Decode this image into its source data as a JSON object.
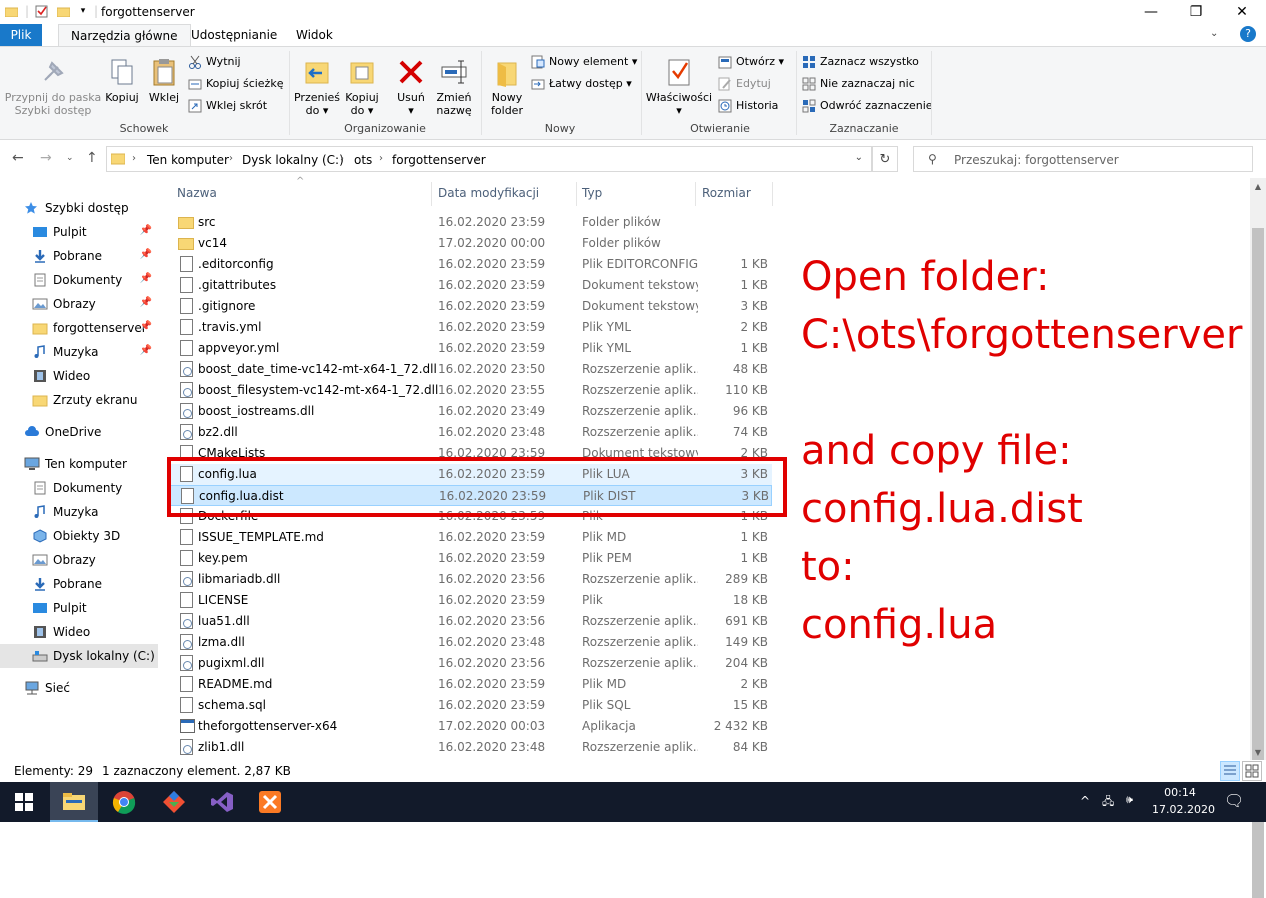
{
  "window": {
    "title": "forgottenserver",
    "minimize": "—",
    "maximize": "❐",
    "close": "✕",
    "help": "?"
  },
  "tabs": [
    {
      "label": "Plik"
    },
    {
      "label": "Narzędzia główne"
    },
    {
      "label": "Udostępnianie"
    },
    {
      "label": "Widok"
    }
  ],
  "ribbon": {
    "pin_label": "Przypnij do paska\nSzybki dostęp",
    "copy_label": "Kopiuj",
    "paste_label": "Wklej",
    "cut_label": "Wytnij",
    "copy_path_label": "Kopiuj ścieżkę",
    "paste_shortcut_label": "Wklej skrót",
    "clipboard_group": "Schowek",
    "move_to_label": "Przenieś\ndo ▾",
    "copy_to_label": "Kopiuj\ndo ▾",
    "delete_label": "Usuń\n▾",
    "rename_label": "Zmień\nnazwę",
    "organize_group": "Organizowanie",
    "new_folder_label": "Nowy\nfolder",
    "new_item_label": "Nowy element ▾",
    "easy_access_label": "Łatwy dostęp ▾",
    "new_group": "Nowy",
    "properties_label": "Właściwości\n▾",
    "open_label": "Otwórz ▾",
    "edit_label": "Edytuj",
    "history_label": "Historia",
    "open_group": "Otwieranie",
    "select_all_label": "Zaznacz wszystko",
    "select_none_label": "Nie zaznaczaj nic",
    "invert_selection_label": "Odwróć zaznaczenie",
    "select_group": "Zaznaczanie"
  },
  "address": {
    "crumbs": [
      "Ten komputer",
      "Dysk lokalny (C:)",
      "ots",
      "forgottenserver"
    ],
    "search_placeholder": "Przeszukaj: forgottenserver"
  },
  "sidebar": [
    {
      "label": "Szybki dostęp",
      "icon": "star-icon",
      "pinned": false,
      "indent": 0
    },
    {
      "label": "Pulpit",
      "icon": "desktop-icon",
      "pinned": true,
      "indent": 1
    },
    {
      "label": "Pobrane",
      "icon": "download-icon",
      "pinned": true,
      "indent": 1
    },
    {
      "label": "Dokumenty",
      "icon": "documents-icon",
      "pinned": true,
      "indent": 1
    },
    {
      "label": "Obrazy",
      "icon": "pictures-icon",
      "pinned": true,
      "indent": 1
    },
    {
      "label": "forgottenserver",
      "icon": "folder-icon",
      "pinned": true,
      "indent": 1
    },
    {
      "label": "Muzyka",
      "icon": "music-icon",
      "pinned": true,
      "indent": 1
    },
    {
      "label": "Wideo",
      "icon": "video-icon",
      "pinned": false,
      "indent": 1
    },
    {
      "label": "Zrzuty ekranu",
      "icon": "folder-icon",
      "pinned": false,
      "indent": 1
    },
    {
      "label": "OneDrive",
      "icon": "cloud-icon",
      "pinned": false,
      "indent": 0
    },
    {
      "label": "Ten komputer",
      "icon": "computer-icon",
      "pinned": false,
      "indent": 0
    },
    {
      "label": "Dokumenty",
      "icon": "documents-icon",
      "pinned": false,
      "indent": 1
    },
    {
      "label": "Muzyka",
      "icon": "music-icon",
      "pinned": false,
      "indent": 1
    },
    {
      "label": "Obiekty 3D",
      "icon": "cube-icon",
      "pinned": false,
      "indent": 1
    },
    {
      "label": "Obrazy",
      "icon": "pictures-icon",
      "pinned": false,
      "indent": 1
    },
    {
      "label": "Pobrane",
      "icon": "download-icon",
      "pinned": false,
      "indent": 1
    },
    {
      "label": "Pulpit",
      "icon": "desktop-icon",
      "pinned": false,
      "indent": 1
    },
    {
      "label": "Wideo",
      "icon": "video-icon",
      "pinned": false,
      "indent": 1
    },
    {
      "label": "Dysk lokalny (C:)",
      "icon": "drive-icon",
      "pinned": false,
      "indent": 1,
      "selected": true
    },
    {
      "label": "Sieć",
      "icon": "network-icon",
      "pinned": false,
      "indent": 0
    }
  ],
  "columns": {
    "name": "Nazwa",
    "date": "Data modyfikacji",
    "type": "Typ",
    "size": "Rozmiar"
  },
  "files": [
    {
      "name": "src",
      "date": "16.02.2020 23:59",
      "type": "Folder plików",
      "size": "",
      "icon": "folder"
    },
    {
      "name": "vc14",
      "date": "17.02.2020 00:00",
      "type": "Folder plików",
      "size": "",
      "icon": "folder"
    },
    {
      "name": ".editorconfig",
      "date": "16.02.2020 23:59",
      "type": "Plik EDITORCONFIG",
      "size": "1 KB",
      "icon": "doc"
    },
    {
      "name": ".gitattributes",
      "date": "16.02.2020 23:59",
      "type": "Dokument tekstowy",
      "size": "1 KB",
      "icon": "doc"
    },
    {
      "name": ".gitignore",
      "date": "16.02.2020 23:59",
      "type": "Dokument tekstowy",
      "size": "3 KB",
      "icon": "doc"
    },
    {
      "name": ".travis.yml",
      "date": "16.02.2020 23:59",
      "type": "Plik YML",
      "size": "2 KB",
      "icon": "doc"
    },
    {
      "name": "appveyor.yml",
      "date": "16.02.2020 23:59",
      "type": "Plik YML",
      "size": "1 KB",
      "icon": "doc"
    },
    {
      "name": "boost_date_time-vc142-mt-x64-1_72.dll",
      "date": "16.02.2020 23:50",
      "type": "Rozszerzenie aplik...",
      "size": "48 KB",
      "icon": "dll"
    },
    {
      "name": "boost_filesystem-vc142-mt-x64-1_72.dll",
      "date": "16.02.2020 23:55",
      "type": "Rozszerzenie aplik...",
      "size": "110 KB",
      "icon": "dll"
    },
    {
      "name": "boost_iostreams.dll",
      "date": "16.02.2020 23:49",
      "type": "Rozszerzenie aplik...",
      "size": "96 KB",
      "icon": "dll"
    },
    {
      "name": "bz2.dll",
      "date": "16.02.2020 23:48",
      "type": "Rozszerzenie aplik...",
      "size": "74 KB",
      "icon": "dll"
    },
    {
      "name": "CMakeLists",
      "date": "16.02.2020 23:59",
      "type": "Dokument tekstowy",
      "size": "2 KB",
      "icon": "doc"
    },
    {
      "name": "config.lua",
      "date": "16.02.2020 23:59",
      "type": "Plik LUA",
      "size": "3 KB",
      "icon": "doc",
      "state": "hl"
    },
    {
      "name": "config.lua.dist",
      "date": "16.02.2020 23:59",
      "type": "Plik DIST",
      "size": "3 KB",
      "icon": "doc",
      "state": "sel"
    },
    {
      "name": "Dockerfile",
      "date": "16.02.2020 23:59",
      "type": "Plik",
      "size": "1 KB",
      "icon": "doc"
    },
    {
      "name": "ISSUE_TEMPLATE.md",
      "date": "16.02.2020 23:59",
      "type": "Plik MD",
      "size": "1 KB",
      "icon": "doc"
    },
    {
      "name": "key.pem",
      "date": "16.02.2020 23:59",
      "type": "Plik PEM",
      "size": "1 KB",
      "icon": "doc"
    },
    {
      "name": "libmariadb.dll",
      "date": "16.02.2020 23:56",
      "type": "Rozszerzenie aplik...",
      "size": "289 KB",
      "icon": "dll"
    },
    {
      "name": "LICENSE",
      "date": "16.02.2020 23:59",
      "type": "Plik",
      "size": "18 KB",
      "icon": "doc"
    },
    {
      "name": "lua51.dll",
      "date": "16.02.2020 23:56",
      "type": "Rozszerzenie aplik...",
      "size": "691 KB",
      "icon": "dll"
    },
    {
      "name": "lzma.dll",
      "date": "16.02.2020 23:48",
      "type": "Rozszerzenie aplik...",
      "size": "149 KB",
      "icon": "dll"
    },
    {
      "name": "pugixml.dll",
      "date": "16.02.2020 23:56",
      "type": "Rozszerzenie aplik...",
      "size": "204 KB",
      "icon": "dll"
    },
    {
      "name": "README.md",
      "date": "16.02.2020 23:59",
      "type": "Plik MD",
      "size": "2 KB",
      "icon": "doc"
    },
    {
      "name": "schema.sql",
      "date": "16.02.2020 23:59",
      "type": "Plik SQL",
      "size": "15 KB",
      "icon": "doc"
    },
    {
      "name": "theforgottenserver-x64",
      "date": "17.02.2020 00:03",
      "type": "Aplikacja",
      "size": "2 432 KB",
      "icon": "exe"
    },
    {
      "name": "zlib1.dll",
      "date": "16.02.2020 23:48",
      "type": "Rozszerzenie aplik...",
      "size": "84 KB",
      "icon": "dll"
    }
  ],
  "annotation": {
    "text": "Open folder:\nC:\\ots\\forgottenserver\n\nand copy file:\nconfig.lua.dist\nto:\nconfig.lua",
    "color": "#e00000"
  },
  "status": {
    "count": "Elementy: 29",
    "selection": "1 zaznaczony element. 2,87 KB"
  },
  "taskbar": {
    "time": "00:14",
    "date": "17.02.2020",
    "apps": [
      "start-icon",
      "file-explorer-icon",
      "chrome-icon",
      "git-icon",
      "visual-studio-icon",
      "xampp-icon"
    ]
  }
}
